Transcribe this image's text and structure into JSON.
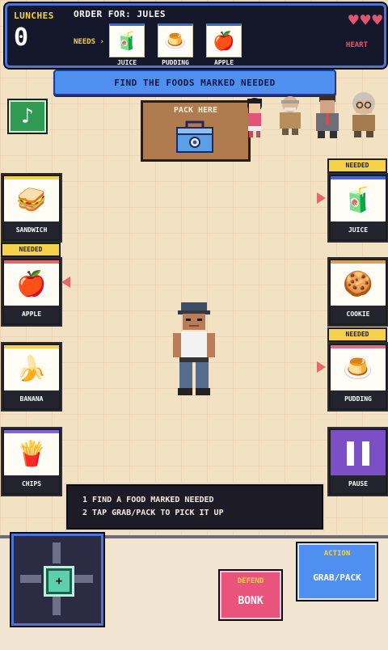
{
  "hud": {
    "lunches_label": "LUNCHES",
    "lunches_count": "0",
    "order_label": "ORDER FOR: JULES",
    "needs_label": "NEEDS ›",
    "needs": [
      {
        "label": "JUICE",
        "icon": "juice-box-icon",
        "glyph": "🧃"
      },
      {
        "label": "PUDDING",
        "icon": "pudding-icon",
        "glyph": "🍮"
      },
      {
        "label": "APPLE",
        "icon": "apple-icon",
        "glyph": "🍎"
      }
    ],
    "hearts": [
      "♥",
      "♥",
      "♥"
    ],
    "heart_label": "HEART"
  },
  "banner": "FIND THE FOODS MARKED NEEDED",
  "music_icon": "♪",
  "pack_zone": {
    "label": "PACK HERE"
  },
  "foods": {
    "sandwich": {
      "label": "SANDWICH",
      "glyph": "🥪",
      "needed": false
    },
    "apple": {
      "label": "APPLE",
      "glyph": "🍎",
      "needed": true
    },
    "banana": {
      "label": "BANANA",
      "glyph": "🍌",
      "needed": false
    },
    "chips": {
      "label": "CHIPS",
      "glyph": "🍟",
      "needed": false
    },
    "juice": {
      "label": "JUICE",
      "glyph": "🧃",
      "needed": true
    },
    "cookie": {
      "label": "COOKIE",
      "glyph": "🍪",
      "needed": false
    },
    "pudding": {
      "label": "PUDDING",
      "glyph": "🍮",
      "needed": true
    }
  },
  "needed_tag": "NEEDED",
  "pause_label": "PAUSE",
  "hint": {
    "line1": "1  FIND A FOOD MARKED NEEDED",
    "line2": "2  TAP GRAB/PACK TO PICK IT UP"
  },
  "controls": {
    "dpad_center": "+",
    "action_top": "ACTION",
    "action_main": "GRAB/PACK",
    "defend_top": "DEFEND",
    "defend_main": "BONK"
  },
  "colors": {
    "hud_bg": "#15172b",
    "hud_border": "#4e74d4",
    "accent_yellow": "#f6d24a",
    "heart_pink": "#e0566e",
    "banner_blue": "#4e8ff0",
    "defend_pink": "#e8547c",
    "pause_purple": "#7b4fc6"
  }
}
